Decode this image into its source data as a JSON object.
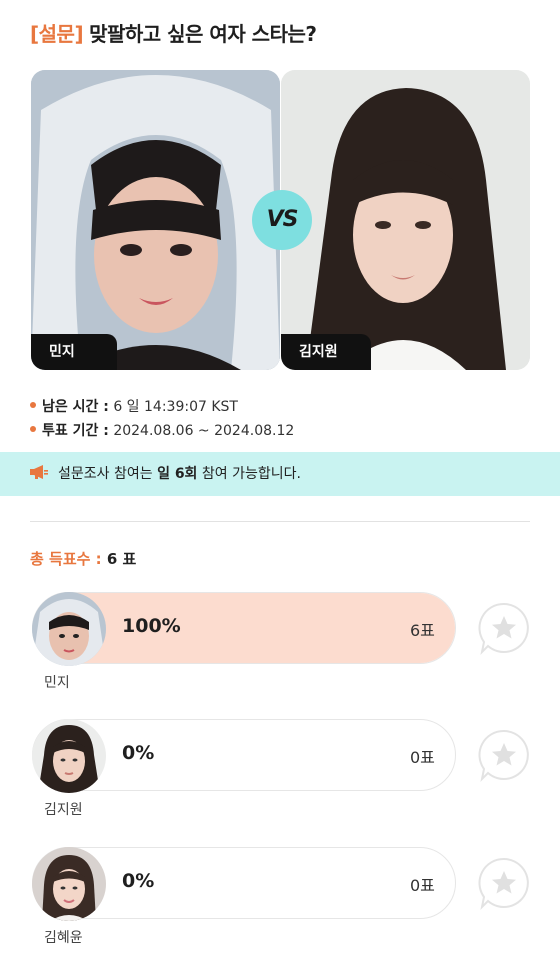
{
  "header": {
    "tag": "[설문]",
    "question": "맞팔하고 싶은 여자 스타는?"
  },
  "matchup": {
    "left_name": "민지",
    "right_name": "김지원",
    "vs_label": "VS"
  },
  "info": {
    "remaining_label": "남은 시간 :",
    "remaining_value": "6 일 14:39:07 KST",
    "period_label": "투표 기간 :",
    "period_value": "2024.08.06 ~ 2024.08.12"
  },
  "notice": {
    "prefix": "설문조사 참여는 ",
    "highlight": "일 6회",
    "suffix": " 참여 가능합니다."
  },
  "total": {
    "label": "총 득표수 :",
    "value": "6 표"
  },
  "results": [
    {
      "name": "민지",
      "percent_text": "100%",
      "votes_text": "6표",
      "percent": 100
    },
    {
      "name": "김지원",
      "percent_text": "0%",
      "votes_text": "0표",
      "percent": 0
    },
    {
      "name": "김혜윤",
      "percent_text": "0%",
      "votes_text": "0표",
      "percent": 0
    }
  ],
  "colors": {
    "accent": "#e8773f",
    "vs_bg": "#7edfe0",
    "notice_bg": "#c9f3f1",
    "bar_fill": "#fcdccf"
  },
  "icons": {
    "notice": "megaphone-icon",
    "vote": "star-bubble-icon"
  }
}
